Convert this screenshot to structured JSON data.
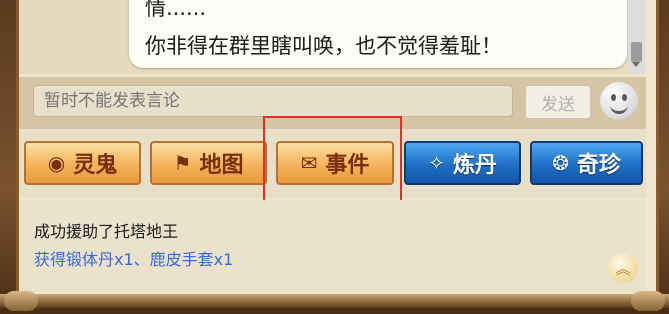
{
  "chat": {
    "line1": "情......",
    "line2": "你非得在群里瞎叫唤，也不觉得羞耻！"
  },
  "input": {
    "placeholder": "暂时不能发表言论",
    "send_label": "发送"
  },
  "tabs": [
    {
      "label": "灵鬼",
      "icon": "orb-icon",
      "style": "orange"
    },
    {
      "label": "地图",
      "icon": "map-icon",
      "style": "orange"
    },
    {
      "label": "事件",
      "icon": "scroll-icon",
      "style": "orange",
      "highlighted": true
    },
    {
      "label": "炼丹",
      "icon": "pill-icon",
      "style": "blue"
    },
    {
      "label": "奇珍",
      "icon": "treasure-icon",
      "style": "blue"
    }
  ],
  "log": {
    "line1": "成功援助了托塔地王",
    "line2": "获得锻体丹x1、鹿皮手套x1"
  },
  "colors": {
    "highlight_border": "#e0302a",
    "reward_text": "#3a6ad6",
    "tab_orange": "#f4b35b",
    "tab_blue": "#1e6ec8"
  }
}
